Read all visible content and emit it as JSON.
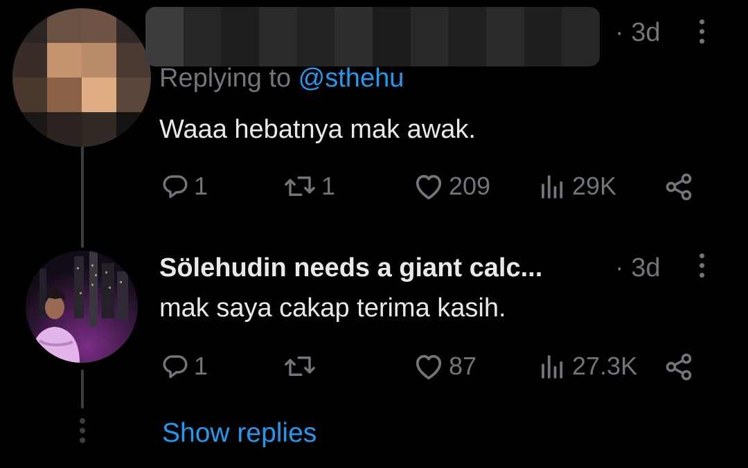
{
  "reply1": {
    "time": "· 3d",
    "replying_prefix": "Replying to ",
    "replying_handle": "@sthehu",
    "text": "Waaa hebatnya mak awak.",
    "stats": {
      "replies": "1",
      "retweets": "1",
      "likes": "209",
      "views": "29K"
    }
  },
  "reply2": {
    "display_name": "Sölehudin needs a giant calc...",
    "time": "· 3d",
    "text": "mak saya cakap terima kasih.",
    "stats": {
      "replies": "1",
      "retweets": "",
      "likes": "87",
      "views": "27.3K"
    }
  },
  "show_replies": "Show replies",
  "icons": [
    "reply-icon",
    "retweet-icon",
    "like-icon",
    "views-icon",
    "share-icon",
    "more-icon"
  ],
  "colors": {
    "background": "#000000",
    "text": "#e7e9ea",
    "muted": "#71767b",
    "link": "#1d9bf0"
  }
}
